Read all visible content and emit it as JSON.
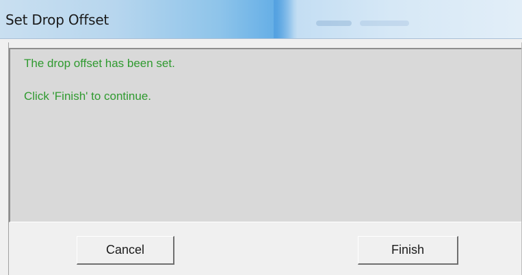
{
  "dialog": {
    "title": "Set Drop Offset",
    "messages": [
      "The drop offset has been set.",
      "Click 'Finish' to continue."
    ],
    "buttons": {
      "cancel_label": "Cancel",
      "finish_label": "Finish"
    }
  },
  "colors": {
    "message_text": "#2f9a2f",
    "panel_background": "#d9d9d9",
    "titlebar_accent": "#64aee6"
  }
}
